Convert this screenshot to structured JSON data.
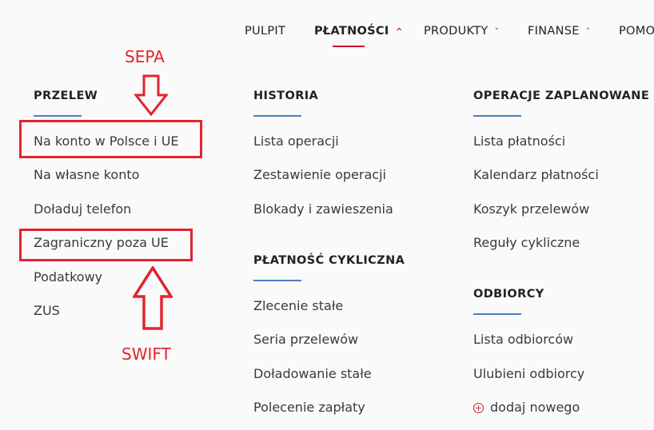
{
  "nav": {
    "items": [
      "PULPIT",
      "PŁATNOŚCI",
      "PRODUKTY",
      "FINANSE",
      "POMO"
    ],
    "chevrons": [
      "^",
      "˅",
      "˅"
    ]
  },
  "przelew": {
    "heading": "PRZELEW",
    "links": [
      "Na konto w Polsce i UE",
      "Na własne konto",
      "Doładuj telefon",
      "Zagraniczny poza UE",
      "Podatkowy",
      "ZUS"
    ]
  },
  "historia": {
    "heading": "HISTORIA",
    "links": [
      "Lista operacji",
      "Zestawienie operacji",
      "Blokady i zawieszenia"
    ]
  },
  "cykliczna": {
    "heading": "PŁATNOŚĆ CYKLICZNA",
    "links": [
      "Zlecenie stałe",
      "Seria przelewów",
      "Doładowanie stałe",
      "Polecenie zapłaty"
    ]
  },
  "zaplanowane": {
    "heading": "OPERACJE ZAPLANOWANE",
    "links": [
      "Lista płatności",
      "Kalendarz płatności",
      "Koszyk przelewów",
      "Reguły cykliczne"
    ]
  },
  "odbiorcy": {
    "heading": "ODBIORCY",
    "links": [
      "Lista odbiorców",
      "Ulubieni odbiorcy",
      "dodaj nowego"
    ]
  },
  "annotations": {
    "top": "SEPA",
    "bottom": "SWIFT"
  },
  "colors": {
    "annotation": "#e2242c",
    "accent": "#c8102e",
    "underline": "#4a7fc1"
  }
}
